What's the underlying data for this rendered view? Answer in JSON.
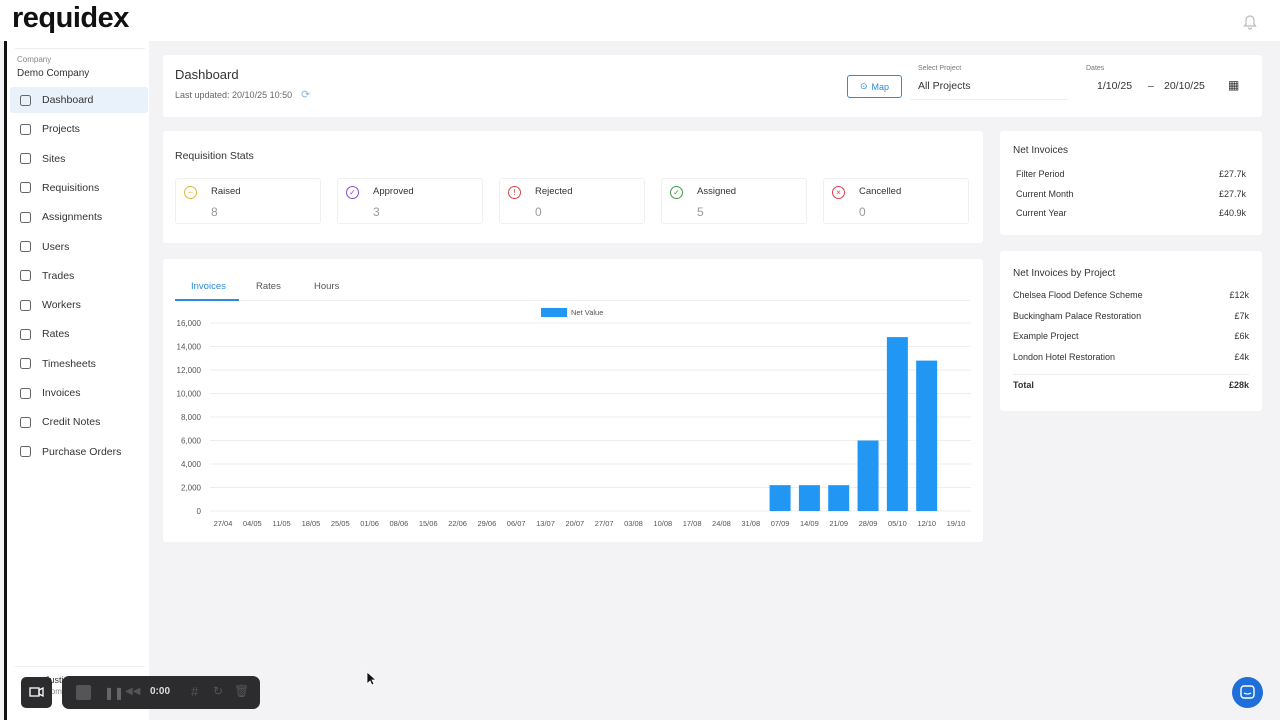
{
  "app": {
    "logo": "requidex"
  },
  "sidebar": {
    "company_label": "Company",
    "company_name": "Demo Company",
    "items": [
      {
        "label": "Dashboard",
        "icon": "grid-icon"
      },
      {
        "label": "Projects",
        "icon": "buildings-icon"
      },
      {
        "label": "Sites",
        "icon": "pin-icon"
      },
      {
        "label": "Requisitions",
        "icon": "list-icon"
      },
      {
        "label": "Assignments",
        "icon": "badge-icon"
      },
      {
        "label": "Users",
        "icon": "users-icon"
      },
      {
        "label": "Trades",
        "icon": "trades-icon"
      },
      {
        "label": "Workers",
        "icon": "workers-icon"
      },
      {
        "label": "Rates",
        "icon": "coin-icon"
      },
      {
        "label": "Timesheets",
        "icon": "calendar-icon"
      },
      {
        "label": "Invoices",
        "icon": "document-icon"
      },
      {
        "label": "Credit Notes",
        "icon": "document-icon"
      },
      {
        "label": "Purchase Orders",
        "icon": "receipt-icon"
      }
    ],
    "user_name": "Justin",
    "user_sub": "Comp"
  },
  "header": {
    "title": "Dashboard",
    "last_updated": "Last updated: 20/10/25 10:50",
    "map_label": "Map",
    "project_label": "Select Project",
    "project_value": "All Projects",
    "dates_label": "Dates",
    "date_from": "1/10/25",
    "date_sep": "–",
    "date_to": "20/10/25"
  },
  "stats": {
    "title": "Requisition Stats",
    "items": [
      {
        "label": "Raised",
        "value": "8",
        "color": "#e0b43c"
      },
      {
        "label": "Approved",
        "value": "3",
        "color": "#8a4fc9"
      },
      {
        "label": "Rejected",
        "value": "0",
        "color": "#d9434b"
      },
      {
        "label": "Assigned",
        "value": "5",
        "color": "#3f9b45"
      },
      {
        "label": "Cancelled",
        "value": "0",
        "color": "#d9434b"
      }
    ]
  },
  "tabs": [
    "Invoices",
    "Rates",
    "Hours"
  ],
  "net_invoices": {
    "title": "Net Invoices",
    "rows": [
      {
        "label": "Filter Period",
        "value": "£27.7k"
      },
      {
        "label": "Current Month",
        "value": "£27.7k"
      },
      {
        "label": "Current Year",
        "value": "£40.9k"
      }
    ]
  },
  "by_project": {
    "title": "Net Invoices by Project",
    "rows": [
      {
        "label": "Chelsea Flood Defence Scheme",
        "value": "£12k"
      },
      {
        "label": "Buckingham Palace Restoration",
        "value": "£7k"
      },
      {
        "label": "Example Project",
        "value": "£6k"
      },
      {
        "label": "London Hotel Restoration",
        "value": "£4k"
      }
    ],
    "total_label": "Total",
    "total_value": "£28k"
  },
  "recorder": {
    "time": "0:00"
  },
  "chart_data": {
    "type": "bar",
    "legend": [
      "Net Value"
    ],
    "legend_position": "top",
    "color": "#2196f3",
    "categories": [
      "27/04",
      "04/05",
      "11/05",
      "18/05",
      "25/05",
      "01/06",
      "08/06",
      "15/06",
      "22/06",
      "29/06",
      "06/07",
      "13/07",
      "20/07",
      "27/07",
      "03/08",
      "10/08",
      "17/08",
      "24/08",
      "31/08",
      "07/09",
      "14/09",
      "21/09",
      "28/09",
      "05/10",
      "12/10",
      "19/10"
    ],
    "values": [
      0,
      0,
      0,
      0,
      0,
      0,
      0,
      0,
      0,
      0,
      0,
      0,
      0,
      0,
      0,
      0,
      0,
      0,
      0,
      2200,
      2200,
      2200,
      6000,
      14800,
      12800,
      0
    ],
    "ylim": [
      0,
      16000
    ],
    "yticks": [
      "0",
      "2,000",
      "4,000",
      "6,000",
      "8,000",
      "10,000",
      "12,000",
      "14,000",
      "16,000"
    ],
    "grid": true
  }
}
